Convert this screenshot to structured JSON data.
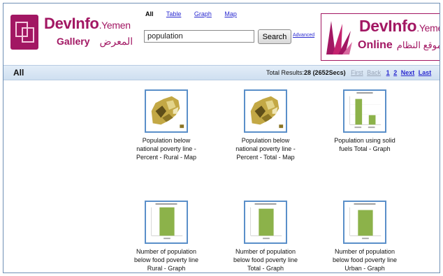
{
  "header": {
    "logo_left": {
      "brand": "DevInfo",
      "country": ".Yemen",
      "gallery": "Gallery",
      "gallery_ar": "المعرض"
    },
    "tabs": [
      {
        "label": "All",
        "active": true
      },
      {
        "label": "Table",
        "active": false
      },
      {
        "label": "Graph",
        "active": false
      },
      {
        "label": "Map",
        "active": false
      }
    ],
    "search": {
      "value": "population",
      "button": "Search",
      "advanced": "Advanced"
    },
    "logo_right": {
      "brand": "DevInfo",
      "country": ".Yemen",
      "online": "Online",
      "online_ar": "موقع النظام"
    }
  },
  "results": {
    "category": "All",
    "total_label": "Total Results:",
    "total_count": "28",
    "time": "(2652Secs)",
    "pager": {
      "first": "First",
      "back": "Back",
      "page1": "1",
      "page2": "2",
      "next": "Next",
      "last": "Last"
    }
  },
  "items": [
    {
      "type": "map",
      "lines": [
        "Population below",
        "national poverty line -",
        "Percent - Rural - Map"
      ]
    },
    {
      "type": "map",
      "lines": [
        "Population below",
        "national poverty line -",
        "Percent - Total - Map"
      ]
    },
    {
      "type": "graph",
      "lines": [
        "Population using solid",
        "fuels Total - Graph"
      ]
    },
    {
      "type": "graph",
      "lines": [
        "Number of population",
        "below food poverty line",
        "Rural - Graph"
      ]
    },
    {
      "type": "graph",
      "lines": [
        "Number of population",
        "below food poverty line",
        "Total - Graph"
      ]
    },
    {
      "type": "graph",
      "lines": [
        "Number of population",
        "below food poverty line",
        "Urban - Graph"
      ]
    }
  ],
  "colors": {
    "brand": "#a21763",
    "link": "#2a2ad0",
    "thumb_border": "#5a8fc9",
    "bar": "#8cb24a",
    "map": "#b59a35"
  }
}
